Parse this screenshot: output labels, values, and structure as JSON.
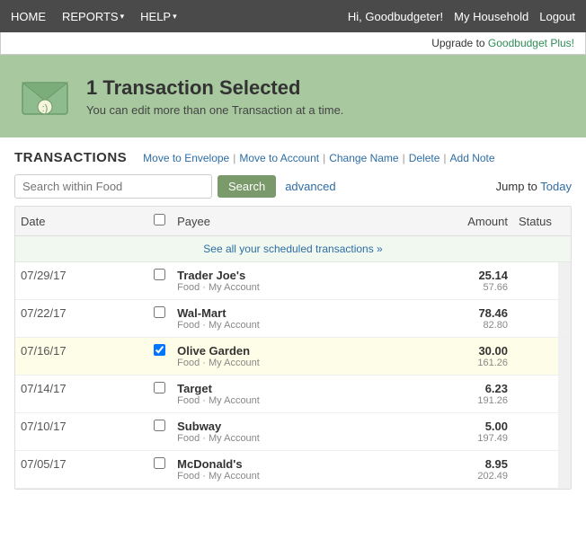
{
  "nav": {
    "items": [
      "HOME",
      "REPORTS",
      "HELP"
    ],
    "dropdown_items": [
      "REPORTS",
      "HELP"
    ],
    "greeting": "Hi, Goodbudgeter!",
    "my_household": "My Household",
    "logout": "Logout"
  },
  "upgrade": {
    "text": "Upgrade to ",
    "link_text": "Goodbudget Plus!",
    "suffix": ""
  },
  "hero": {
    "title": "1 Transaction Selected",
    "subtitle": "You can edit more than one Transaction at a time."
  },
  "transactions": {
    "title": "TRANSACTIONS",
    "actions": [
      {
        "label": "Move to Envelope",
        "key": "move-envelope"
      },
      {
        "label": "Move to Account",
        "key": "move-account"
      },
      {
        "label": "Change Name",
        "key": "change-name"
      },
      {
        "label": "Delete",
        "key": "delete"
      },
      {
        "label": "Add Note",
        "key": "add-note"
      }
    ],
    "search_placeholder": "Search within Food",
    "search_btn": "Search",
    "advanced_link": "advanced",
    "jump_to_label": "Jump to ",
    "jump_to_link": "Today",
    "columns": {
      "date": "Date",
      "payee": "Payee",
      "amount": "Amount",
      "status": "Status"
    },
    "scheduled_banner": "See all your scheduled transactions »",
    "rows": [
      {
        "date": "07/29/17",
        "payee": "Trader Joe's",
        "sub": "Food · My Account",
        "amount": "25.14",
        "balance": "57.66",
        "selected": false
      },
      {
        "date": "07/22/17",
        "payee": "Wal-Mart",
        "sub": "Food · My Account",
        "amount": "78.46",
        "balance": "82.80",
        "selected": false
      },
      {
        "date": "07/16/17",
        "payee": "Olive Garden",
        "sub": "Food · My Account",
        "amount": "30.00",
        "balance": "161.26",
        "selected": true
      },
      {
        "date": "07/14/17",
        "payee": "Target",
        "sub": "Food · My Account",
        "amount": "6.23",
        "balance": "191.26",
        "selected": false
      },
      {
        "date": "07/10/17",
        "payee": "Subway",
        "sub": "Food · My Account",
        "amount": "5.00",
        "balance": "197.49",
        "selected": false
      },
      {
        "date": "07/05/17",
        "payee": "McDonald's",
        "sub": "Food · My Account",
        "amount": "8.95",
        "balance": "202.49",
        "selected": false
      }
    ]
  }
}
